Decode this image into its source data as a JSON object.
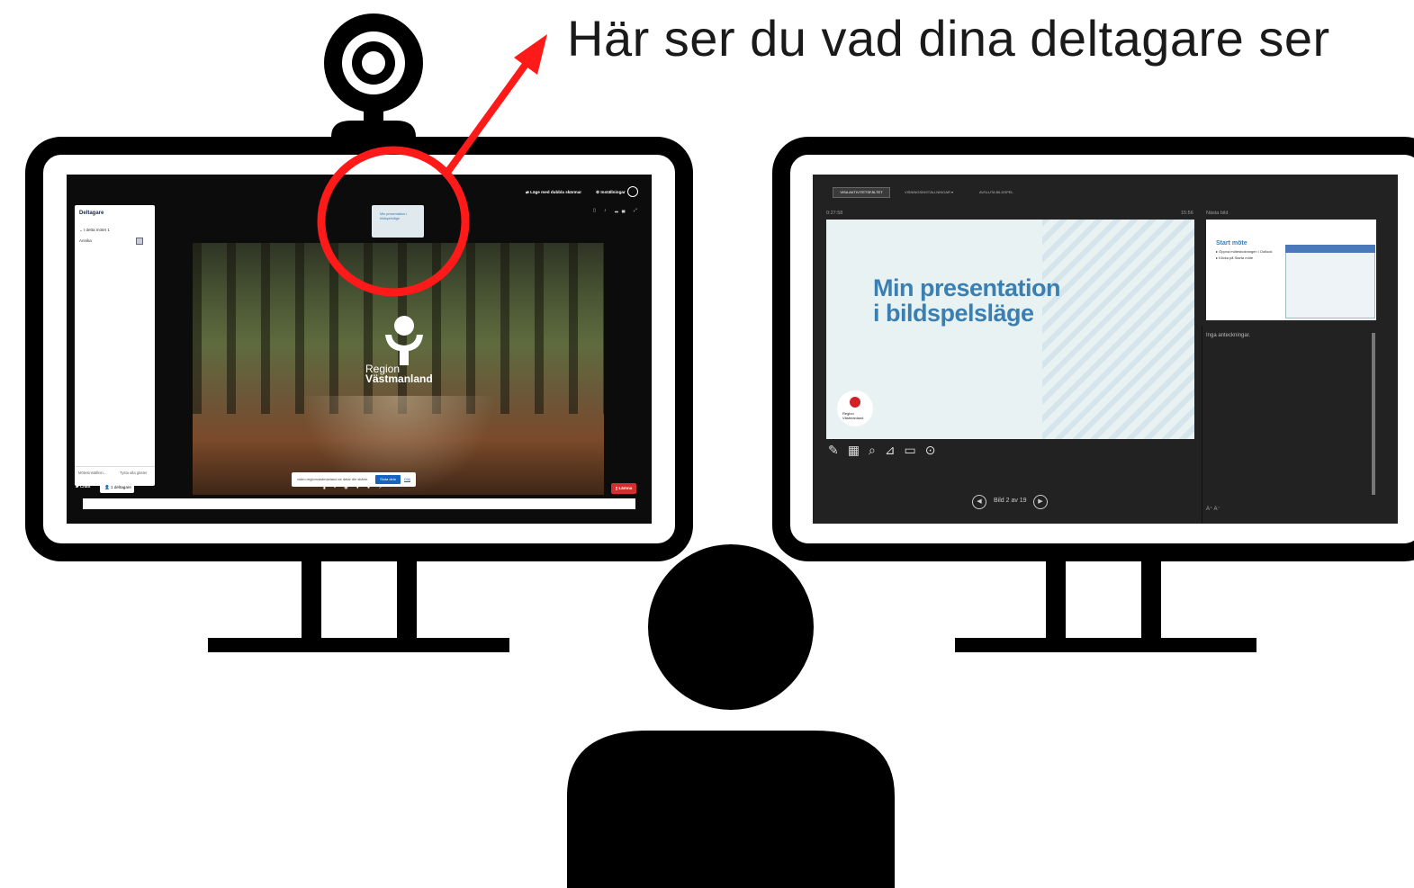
{
  "caption": "Här ser du vad dina deltagare ser",
  "colors": {
    "annotation": "#ff1a1a",
    "outline": "#000000",
    "leave": "#d32f2f",
    "accent_blue": "#1565c0",
    "slide_title": "#3b7fb2"
  },
  "webcam_icon": "webcam-icon",
  "meeting": {
    "panel_title": "Deltagare",
    "section": "I detta mötet",
    "section_count": "1",
    "participant": "Annika",
    "footer_left": "Mötesinställnin...",
    "footer_right": "Tysta alla gäster",
    "topbar_dual": "Läge med dubbla skärmar",
    "topbar_settings": "Inställningar",
    "thumb_title": "Min presentation i bildspelsläge",
    "share_message": "video.regionvastmanland.se delar din skärm.",
    "stop_share": "Sluta dela",
    "hide": "Dölj",
    "chat": "Chatt",
    "participants_btn": "1 deltagare",
    "leave": "Lämna",
    "logo_line1": "Region",
    "logo_line2": "Västmanland"
  },
  "presenter": {
    "show_taskbar": "VISA AKTIVITETSFÄLTET",
    "display_settings": "VISNINGSINSTÄLLNINGAR ▾",
    "end_show": "AVSLUTA BILDSPEL",
    "timer": "0:27:58",
    "clock": "15:56",
    "next_label": "Nästa bild",
    "slide_title_1": "Min presentation",
    "slide_title_2": "i bildspelsläge",
    "logo_line1": "Region",
    "logo_line2": "Västmanland",
    "slide_counter": "Bild 2 av 19",
    "next_slide_title": "Start möte",
    "next_bullet_1": "▸ Öppna mötesbokningen i Outlook",
    "next_bullet_2": "▸ Klicka på Starta möte",
    "notes": "Inga anteckningar."
  }
}
